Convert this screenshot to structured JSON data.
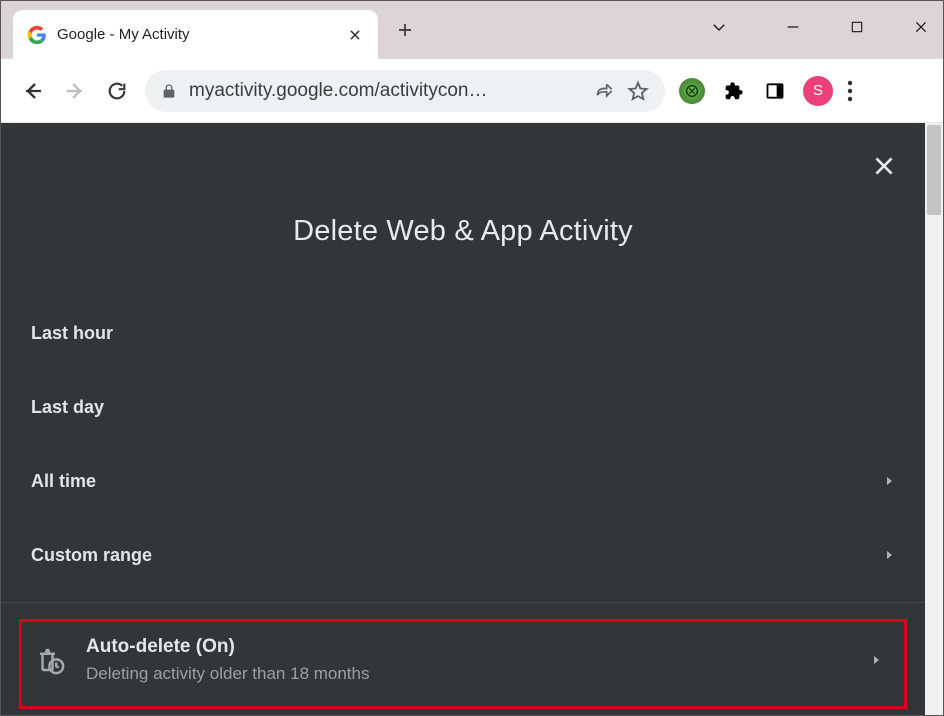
{
  "window": {
    "minimize": "—",
    "maximize": "☐",
    "close": "✕"
  },
  "tab": {
    "title": "Google - My Activity"
  },
  "toolbar": {
    "url": "myactivity.google.com/activitycon…",
    "avatar_initial": "S"
  },
  "page": {
    "title": "Delete Web & App Activity",
    "options": {
      "last_hour": "Last hour",
      "last_day": "Last day",
      "all_time": "All time",
      "custom_range": "Custom range"
    },
    "auto_delete": {
      "title": "Auto-delete (On)",
      "subtitle": "Deleting activity older than 18 months"
    }
  }
}
